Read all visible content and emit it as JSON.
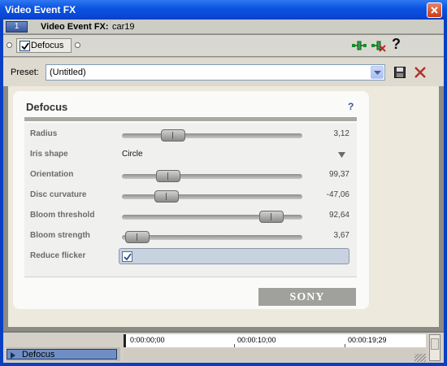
{
  "window": {
    "title": "Video Event FX"
  },
  "header": {
    "track_number": "1",
    "label": "Video Event FX:",
    "event_name": "car19"
  },
  "chain": {
    "plugin_label": "Defocus",
    "plugin_enabled": true
  },
  "preset": {
    "label": "Preset:",
    "value": "(Untitled)"
  },
  "panel": {
    "title": "Defocus",
    "help": "?",
    "params": [
      {
        "label": "Radius",
        "type": "slider",
        "value": "3,12",
        "position": 0.25
      },
      {
        "label": "Iris shape",
        "type": "select",
        "value": "Circle"
      },
      {
        "label": "Orientation",
        "type": "slider",
        "value": "99,37",
        "position": 0.22
      },
      {
        "label": "Disc curvature",
        "type": "slider",
        "value": "-47,06",
        "position": 0.21
      },
      {
        "label": "Bloom threshold",
        "type": "slider",
        "value": "92,64",
        "position": 0.88
      },
      {
        "label": "Bloom strength",
        "type": "slider",
        "value": "3,67",
        "position": 0.02
      },
      {
        "label": "Reduce flicker",
        "type": "checkbox",
        "checked": true
      }
    ],
    "brand": "SONY"
  },
  "timeline": {
    "track_label": "Defocus",
    "timecodes": [
      "0:00:00;00",
      "00:00:10;00",
      "00:00:19;29"
    ]
  },
  "colors": {
    "titlebar": "#0d54e0",
    "accent": "#3a55a8"
  },
  "icons": [
    "close-icon",
    "checkmark-icon",
    "fx-plugin-chain-icon",
    "fx-remove-icon",
    "help-icon",
    "save-preset-icon",
    "delete-preset-icon",
    "dropdown-arrow-icon"
  ]
}
